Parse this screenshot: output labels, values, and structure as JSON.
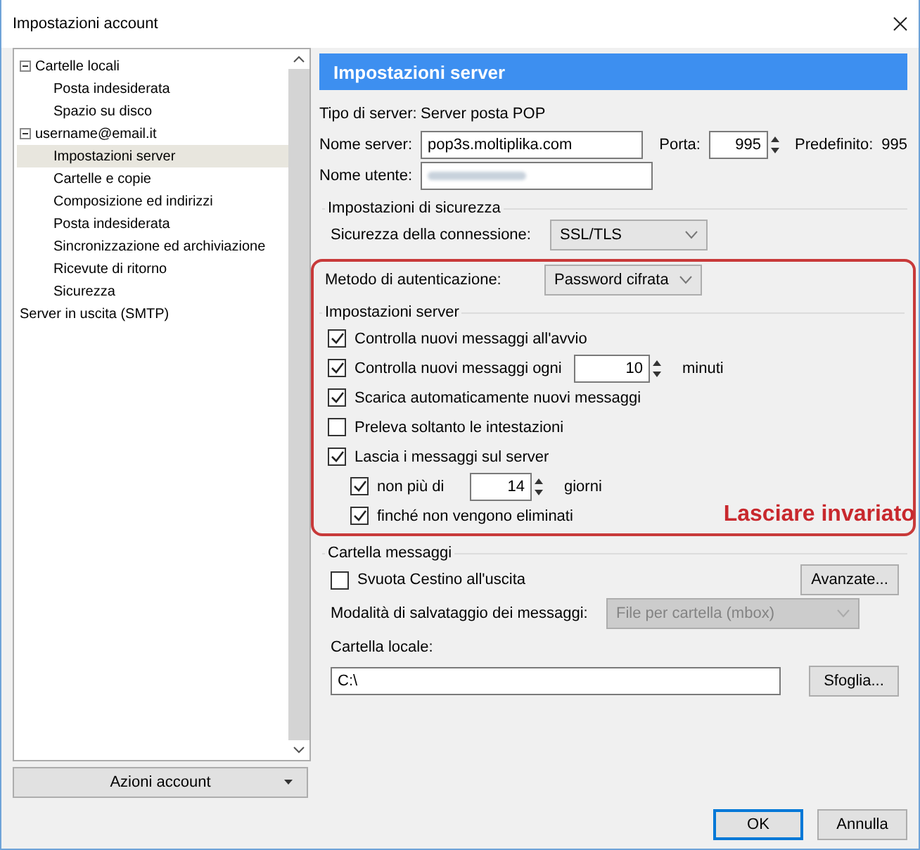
{
  "window": {
    "title": "Impostazioni account"
  },
  "tree": [
    {
      "label": "Cartelle locali",
      "selected": false,
      "expanded": true,
      "children": [
        {
          "label": "Posta indesiderata",
          "selected": false
        },
        {
          "label": "Spazio su disco",
          "selected": false
        }
      ]
    },
    {
      "label": "username@email.it",
      "selected": false,
      "expanded": true,
      "children": [
        {
          "label": "Impostazioni server",
          "selected": true
        },
        {
          "label": "Cartelle e copie",
          "selected": false
        },
        {
          "label": "Composizione ed indirizzi",
          "selected": false
        },
        {
          "label": "Posta indesiderata",
          "selected": false
        },
        {
          "label": "Sincronizzazione ed archiviazione",
          "selected": false
        },
        {
          "label": "Ricevute di ritorno",
          "selected": false
        },
        {
          "label": "Sicurezza",
          "selected": false
        }
      ]
    },
    {
      "label": "Server in uscita (SMTP)",
      "selected": false
    }
  ],
  "account_actions": "Azioni account",
  "header": "Impostazioni server",
  "server_type": {
    "label": "Tipo di server:",
    "value": "Server posta POP"
  },
  "server_name": {
    "label": "Nome server:",
    "value": "pop3s.moltiplika.com"
  },
  "port": {
    "label": "Porta:",
    "value": "995"
  },
  "default_port": {
    "label": "Predefinito:",
    "value": "995"
  },
  "username": {
    "label": "Nome utente:"
  },
  "security": {
    "title": "Impostazioni di sicurezza",
    "connection": {
      "label": "Sicurezza della connessione:",
      "value": "SSL/TLS"
    },
    "auth": {
      "label": "Metodo di autenticazione:",
      "value": "Password cifrata"
    }
  },
  "server_settings": {
    "title": "Impostazioni server",
    "options": [
      {
        "kind": "check",
        "label": "Controlla nuovi messaggi all'avvio",
        "checked": true
      },
      {
        "kind": "spin",
        "label": "Controlla nuovi messaggi ogni",
        "checked": true,
        "value": "10",
        "unit": "minuti"
      },
      {
        "kind": "check",
        "label": "Scarica automaticamente nuovi messaggi",
        "checked": true
      },
      {
        "kind": "check",
        "label": "Preleva soltanto le intestazioni",
        "checked": false
      },
      {
        "kind": "check",
        "label": "Lascia i messaggi sul server",
        "checked": true,
        "children": [
          {
            "kind": "spin",
            "label": "non più di",
            "checked": true,
            "value": "14",
            "unit": "giorni"
          },
          {
            "kind": "check",
            "label": "finché non vengono eliminati",
            "checked": true
          }
        ]
      }
    ]
  },
  "annotation": "Lasciare invariato",
  "message_folder": {
    "title": "Cartella messaggi",
    "empty_trash": {
      "label": "Svuota Cestino all'uscita",
      "checked": false
    },
    "advanced": "Avanzate...",
    "storage": {
      "label": "Modalità di salvataggio dei messaggi:",
      "value": "File per cartella (mbox)",
      "disabled": true
    },
    "local_folder": {
      "label": "Cartella locale:",
      "value": "C:\\"
    },
    "browse": "Sfoglia..."
  },
  "buttons": {
    "ok": "OK",
    "cancel": "Annulla"
  }
}
